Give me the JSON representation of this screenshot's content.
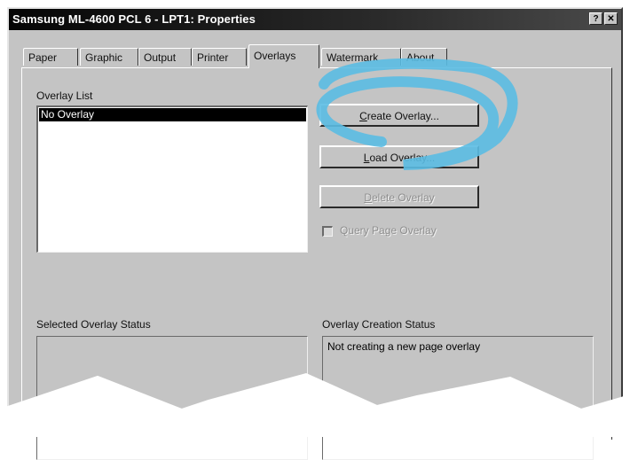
{
  "window": {
    "title": "Samsung ML-4600 PCL 6 - LPT1: Properties",
    "help_glyph": "?",
    "close_glyph": "✕"
  },
  "tabs": [
    "Paper",
    "Graphic",
    "Output",
    "Printer",
    "Overlays",
    "Watermark",
    "About"
  ],
  "active_tab": "Overlays",
  "overlay_list": {
    "label": "Overlay List",
    "items": [
      "No Overlay"
    ],
    "selected": "No Overlay"
  },
  "buttons": {
    "create": {
      "mnemonic": "C",
      "rest": "reate Overlay..."
    },
    "load": {
      "mnemonic": "L",
      "rest": "oad Overlay..."
    },
    "delete": {
      "mnemonic": "D",
      "rest": "elete Overlay"
    }
  },
  "query_checkbox": {
    "label": "Query Page Overlay",
    "checked": false,
    "enabled": false
  },
  "status": {
    "selected_label": "Selected Overlay Status",
    "selected_text": "",
    "creation_label": "Overlay Creation Status",
    "creation_text": "Not creating a new page overlay"
  },
  "colors": {
    "face": "#c4c4c4",
    "title_bar": "#050505",
    "highlight_ring": "#5bbde3"
  }
}
